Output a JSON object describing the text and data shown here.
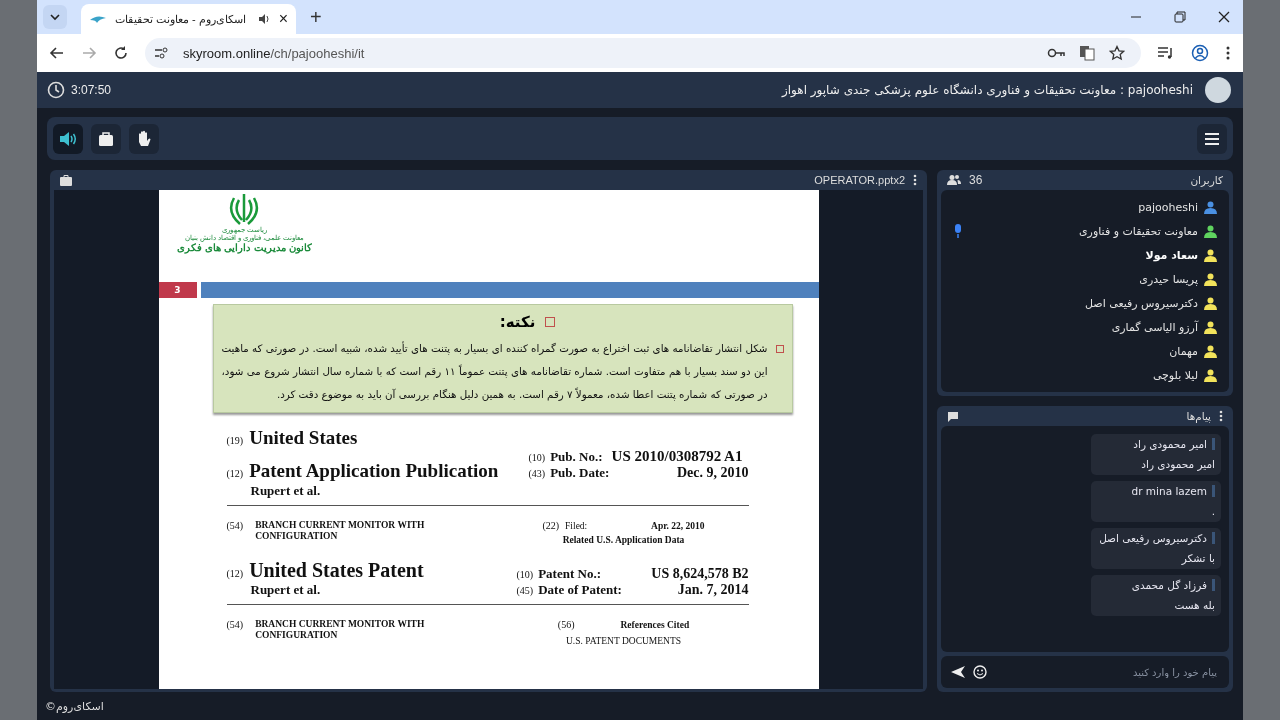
{
  "browser": {
    "tab": {
      "title": "اسکای‌روم - معاونت تحقیقات",
      "audio_playing": true,
      "close": "×"
    },
    "new_tab": "+",
    "url": {
      "host": "skyroom.online",
      "path": "/ch/pajooheshi/it"
    }
  },
  "header": {
    "timer": "3:07:50",
    "room_title": "pajooheshi : معاونت تحقیقات و فناوری دانشگاه علوم پزشکی جندی شاپور اهواز"
  },
  "toolbar": [
    {
      "kind": "speaker",
      "on": true
    },
    {
      "kind": "briefcase",
      "on": false
    },
    {
      "kind": "hand",
      "on": false
    }
  ],
  "presentation": {
    "file": "OPERATOR.pptx2",
    "slide": {
      "logo": [
        "ریاست جمهوری",
        "معاونت علمی، فناوری و اقتصاد دانش بنیان",
        "کانون مدیریت دارایی های فکری"
      ],
      "number": "3",
      "note_title": "نکته:",
      "note_body": "شکل انتشار تقاضانامه های ثبت اختراع به صورت گمراه کننده ای بسیار به پتنت های تأیید شده، شبیه است. در صورتی که ماهیت این دو سند بسیار با هم متفاوت است. شماره تقاضانامه های پتنت عموماً ۱۱ رقم است که با شماره سال انتشار شروع می شود، در صورتی که شماره پتنت اعطا شده، معمولاً ۷ رقم است. به همین دلیل هنگام بررسی آن باید به موضوع دقت کرد.",
      "publication": {
        "country_code": "(19)",
        "country": "United States",
        "type_code": "(12)",
        "type": "Patent Application Publication",
        "inventor": "Rupert et al.",
        "fields": [
          {
            "code": "(10)",
            "label": "Pub. No.:",
            "value": "US 2010/0308792 A1"
          },
          {
            "code": "(43)",
            "label": "Pub. Date:",
            "value": "Dec. 9, 2010"
          }
        ],
        "title_code": "(54)",
        "title": "BRANCH CURRENT MONITOR WITH CONFIGURATION",
        "filed_code": "(22)",
        "filed_label": "Filed:",
        "filed_value": "Apr. 22, 2010",
        "related": "Related U.S. Application Data"
      },
      "grant": {
        "type_code": "(12)",
        "type": "United States Patent",
        "inventor": "Rupert et al.",
        "fields": [
          {
            "code": "(10)",
            "label": "Patent No.:",
            "value": "US 8,624,578 B2"
          },
          {
            "code": "(45)",
            "label": "Date of Patent:",
            "value": "Jan. 7, 2014"
          }
        ],
        "title_code": "(54)",
        "title": "BRANCH CURRENT MONITOR WITH CONFIGURATION",
        "refs_code": "(56)",
        "refs_title": "References Cited",
        "refs_sub": "U.S. PATENT DOCUMENTS"
      }
    }
  },
  "users": {
    "title": "کاربران",
    "count": "36",
    "items": [
      {
        "name": "pajooheshi",
        "color": "#4a90e2",
        "speaking": false,
        "highlighted": false
      },
      {
        "name": "معاونت تحقیقات و فناوری",
        "color": "#5fd35f",
        "speaking": true,
        "highlighted": false
      },
      {
        "name": "سعاد مولا",
        "color": "#f2e35b",
        "speaking": false,
        "highlighted": true
      },
      {
        "name": "پریسا حیدری",
        "color": "#f2e35b",
        "speaking": false,
        "highlighted": false
      },
      {
        "name": "دکترسیروس رفیعی اصل",
        "color": "#f2e35b",
        "speaking": false,
        "highlighted": false
      },
      {
        "name": "آرزو الیاسی گماری",
        "color": "#f2e35b",
        "speaking": false,
        "highlighted": false
      },
      {
        "name": "مهمان",
        "color": "#f2e35b",
        "speaking": false,
        "highlighted": false
      },
      {
        "name": "لیلا بلوچی",
        "color": "#f2e35b",
        "speaking": false,
        "highlighted": false
      }
    ]
  },
  "chat": {
    "title": "پیام‌ها",
    "messages": [
      {
        "sender": "امیر محمودی راد",
        "text": "امیر محمودی راد"
      },
      {
        "sender": "dr mina lazem",
        "text": "."
      },
      {
        "sender": "دکترسیروس رفیعی اصل",
        "text": "با تشکر"
      },
      {
        "sender": "فرزاد گل محمدی",
        "text": "بله هست"
      }
    ],
    "input": {
      "placeholder": "پیام خود را وارد کنید"
    }
  },
  "footer": "©اسکای‌روم"
}
